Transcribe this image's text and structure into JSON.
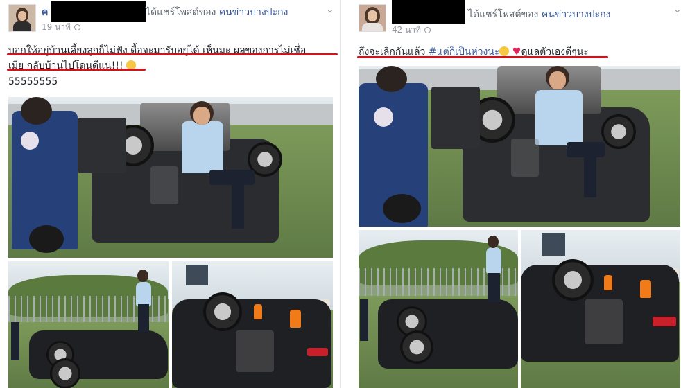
{
  "posts": [
    {
      "author_redacted": "ค",
      "shared_text": "ได้แชร์โพสต์ของ",
      "page_name": "คนข่าวบางปะกง",
      "time": "19 นาที",
      "caption_line1": "บอกให้อยู่บ้านเลี้ยงลูกก็ไม่ฟัง ดื้อจะมารับอยู่ได้ เห็นมะ ผลของการไม่เชื่อ",
      "caption_line2": "เมีย กลับบ้านไปโดนดีแน่!!!",
      "body": "55555555"
    },
    {
      "author_redacted": "",
      "shared_text": "ได้แชร์โพสต์ของ",
      "page_name": "คนข่าวบางปะกง",
      "time": "42 นาที",
      "caption_part1": "ถึงจะเลิกกันแล้ว ",
      "hashtag": "#แต่ก็เป็นห่วงนะ",
      "caption_part2": "ดูแลตัวเองดีๆนะ"
    }
  ],
  "colors": {
    "link": "#365899",
    "underline": "#d0141e",
    "meta": "#90949c"
  },
  "icons": [
    "globe-icon",
    "chevron-down-icon",
    "grinning-emoji-icon",
    "tongue-wink-emoji-icon",
    "heart-icon"
  ]
}
